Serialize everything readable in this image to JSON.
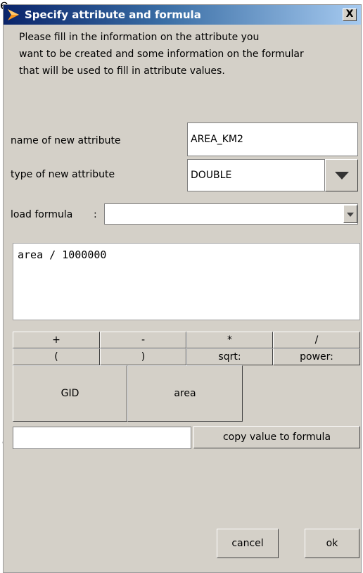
{
  "background_fragments": {
    "left_top": "e",
    "left_mid": "o"
  },
  "window": {
    "title": "Specify attribute and formula",
    "close_label": "X"
  },
  "instructions": [
    "Please fill in the information on the attribute you",
    "want to be created and some information on the formular",
    "that will be used to fill in attribute values."
  ],
  "attribute": {
    "name_label": "name of new attribute",
    "name_value": "AREA_KM2",
    "type_label": "type of new attribute",
    "type_value": "DOUBLE"
  },
  "load_formula": {
    "label": "load formula",
    "separator": ":",
    "value": ""
  },
  "formula_text": "area / 1000000",
  "operators": {
    "row1": [
      "+",
      "-",
      "*",
      "/"
    ],
    "row2": [
      "(",
      ")",
      "sqrt:",
      "power:"
    ]
  },
  "attribute_buttons": [
    "GID",
    "area"
  ],
  "value_input": {
    "value": ""
  },
  "copy_button": "copy value to formula",
  "footer": {
    "cancel": "cancel",
    "ok": "ok"
  },
  "colors": {
    "dialog_bg": "#d4d0c8",
    "title_start": "#0a246a",
    "title_end": "#a6caf0",
    "icon": "#f7941d"
  }
}
